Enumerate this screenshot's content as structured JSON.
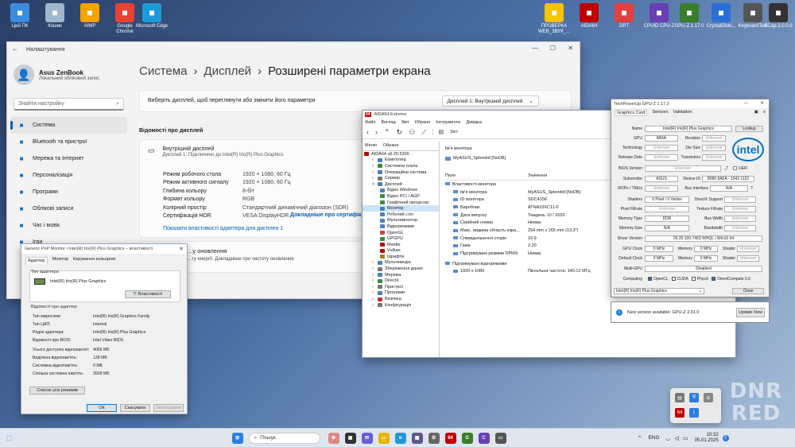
{
  "desktop_icons": [
    {
      "label": "Цей ПК",
      "icon": "computer-icon",
      "color": "#3a8dde"
    },
    {
      "label": "Кошик",
      "icon": "recycle-bin-icon",
      "color": "#9fb6cc"
    },
    {
      "label": "AIMP",
      "icon": "aimp-icon",
      "color": "#f4a300"
    },
    {
      "label": "Google Chrome",
      "icon": "chrome-icon",
      "color": "#e94235"
    },
    {
      "label": "Microsoft Edge",
      "icon": "edge-icon",
      "color": "#1f9ad6"
    },
    {
      "label": "ПРОВЕРКА WEB_ЗВУК_...",
      "icon": "warning-icon",
      "color": "#f5c400"
    },
    {
      "label": "AIDA64",
      "icon": "aida64-icon",
      "color": "#c00000"
    },
    {
      "label": "DPT",
      "icon": "dpt-icon",
      "color": "#e04040"
    },
    {
      "label": "CPUID CPU-Z",
      "icon": "cpuz-icon",
      "color": "#6a3fb5"
    },
    {
      "label": "GPU-Z.1.17.0",
      "icon": "gpuz-icon",
      "color": "#3a7d2a"
    },
    {
      "label": "CrystalDiski...",
      "icon": "crystaldisk-icon",
      "color": "#2a6fd6"
    },
    {
      "label": "KeyboardTest",
      "icon": "keyboard-icon",
      "color": "#555555"
    },
    {
      "label": "ECap-1.0.0.9",
      "icon": "camera-icon",
      "color": "#333333"
    }
  ],
  "settings": {
    "window_title": "Налаштування",
    "account_name": "Asus ZenBook",
    "account_type": "Локальний обліковий запис",
    "search_placeholder": "Знайти настройку",
    "nav": [
      {
        "label": "Система",
        "icon": "system-icon"
      },
      {
        "label": "Bluetooth та пристрої",
        "icon": "bluetooth-icon"
      },
      {
        "label": "Мережа та Інтернет",
        "icon": "network-icon"
      },
      {
        "label": "Персоналізація",
        "icon": "personalization-icon"
      },
      {
        "label": "Програми",
        "icon": "apps-icon"
      },
      {
        "label": "Облікові записи",
        "icon": "accounts-icon"
      },
      {
        "label": "Час і мова",
        "icon": "time-icon"
      },
      {
        "label": "Ігри",
        "icon": "games-icon"
      }
    ],
    "crumb_1": "Система",
    "crumb_2": "Дисплей",
    "crumb_3": "Розширені параметри екрана",
    "select_prompt": "Виберіть дисплей, щоб переглянути або змінити його параметри",
    "display_select": "Дисплей 1: Внутрішній дисплей",
    "info_title": "Відомості про дисплей",
    "display_name": "Внутрішній дисплей",
    "display_sub": "Дисплей 1: Підключено до Intel(R) Iris(R) Plus Graphics",
    "rows": [
      {
        "k": "Режим робочого стола",
        "v": "1920 × 1080, 60 Гц"
      },
      {
        "k": "Режим активного сигналу",
        "v": "1920 × 1080, 60 Гц"
      },
      {
        "k": "Глибина кольору",
        "v": "8-біт"
      },
      {
        "k": "Формат кольору",
        "v": "RGB"
      },
      {
        "k": "Колірний простір",
        "v": "Стандартний динамічний діапазон (SDR)"
      },
      {
        "k": "Сертифікація HDR",
        "v": "VESA DisplayHDR"
      }
    ],
    "hdr_link": "Докладніше про сертифік...",
    "adapter_link": "Показати властивості адаптера для дисплея 1",
    "refresh_title": "...у оновлення",
    "refresh_text": "...ту енергії. Докладніше про частоту оновлення"
  },
  "props": {
    "title": "Generic PnP Monitor і Intel(R) Iris(R) Plus Graphics – властивості",
    "tabs": [
      "Адаптер",
      "Монітор",
      "Керування кольором"
    ],
    "adapter_type_label": "Тип адаптера",
    "adapter_name": "Intel(R) Iris(R) Plus Graphics",
    "properties_button": "Властивості",
    "info_label": "Відомості про адаптер",
    "rows": [
      {
        "k": "Тип мікросхем:",
        "v": "Intel(R) Iris(R) Graphics Family"
      },
      {
        "k": "Тип ЦАП:",
        "v": "Internal"
      },
      {
        "k": "Рядок адаптера:",
        "v": "Intel(R) Iris(R) Plus Graphics"
      },
      {
        "k": "Відомості про BIOS:",
        "v": "Intel Video BIOS"
      }
    ],
    "mem_rows": [
      {
        "k": "Усього доступно відеопам'яті:",
        "v": "4056 МБ"
      },
      {
        "k": "Виділена відеопам'ять:",
        "v": "128 МБ"
      },
      {
        "k": "Системна відеопам'ять:",
        "v": "0 МБ"
      },
      {
        "k": "Спільна системна пам'ять:",
        "v": "3928 МБ"
      }
    ],
    "modes_button": "Список усіх режимів",
    "ok": "ОК",
    "cancel": "Скасувати",
    "apply": "Застосувати"
  },
  "aida": {
    "title": "AIDA64 Extreme",
    "menu": [
      "Файл",
      "Вигляд",
      "Звіт",
      "Обране",
      "Інструменти",
      "Довідка"
    ],
    "report_tab": "Звіт",
    "tree_tabs": [
      "Меню",
      "Обране"
    ],
    "tree": [
      {
        "label": "AIDA64 v6.20.5300",
        "level": 0,
        "color": "#c00000"
      },
      {
        "label": "Комп'ютер",
        "level": 1,
        "color": "#4a7fc1"
      },
      {
        "label": "Системна плата",
        "level": 1,
        "color": "#3a8a3a"
      },
      {
        "label": "Операційна система",
        "level": 1,
        "color": "#4a7fc1"
      },
      {
        "label": "Сервер",
        "level": 1,
        "color": "#777777"
      },
      {
        "label": "Дисплей",
        "level": 1,
        "color": "#4a7fc1"
      },
      {
        "label": "Відео Windows",
        "level": 2,
        "color": "#4a7fc1"
      },
      {
        "label": "Відео PCI / AGP",
        "level": 2,
        "color": "#3a8a3a"
      },
      {
        "label": "Графічний процесор",
        "level": 2,
        "color": "#3a8a3a"
      },
      {
        "label": "Монітор",
        "level": 2,
        "color": "#4a7fc1",
        "selected": true
      },
      {
        "label": "Робочий стіл",
        "level": 2,
        "color": "#4a7fc1"
      },
      {
        "label": "Мультимонітор",
        "level": 2,
        "color": "#4a7fc1"
      },
      {
        "label": "Відеорежими",
        "level": 2,
        "color": "#4a7fc1"
      },
      {
        "label": "OpenGL",
        "level": 2,
        "color": "#d04040"
      },
      {
        "label": "GPGPU",
        "level": 2,
        "color": "#3a8a3a"
      },
      {
        "label": "Mantle",
        "level": 2,
        "color": "#c00000"
      },
      {
        "label": "Vulkan",
        "level": 2,
        "color": "#c00000"
      },
      {
        "label": "Шрифти",
        "level": 2,
        "color": "#a08020"
      },
      {
        "label": "Мультимедіа",
        "level": 1,
        "color": "#4a7fc1"
      },
      {
        "label": "Збереження даних",
        "level": 1,
        "color": "#777777"
      },
      {
        "label": "Мережа",
        "level": 1,
        "color": "#4a7fc1"
      },
      {
        "label": "DirectX",
        "level": 1,
        "color": "#3a8a3a"
      },
      {
        "label": "Пристрої",
        "level": 1,
        "color": "#777777"
      },
      {
        "label": "Програми",
        "level": 1,
        "color": "#4a7fc1"
      },
      {
        "label": "Безпека",
        "level": 1,
        "color": "#c03030"
      },
      {
        "label": "Конфігурація",
        "level": 1,
        "color": "#777777"
      }
    ],
    "monitor_name_label": "Ім'я монітора",
    "monitor_name_value": "MyASUS_Splendid [NoDB]",
    "col_field": "Поле",
    "col_value": "Значення",
    "group1": "Властивості монітора",
    "props": [
      {
        "f": "Ім'я монітора",
        "v": "MyASUS_Splendid [NoDB]"
      },
      {
        "f": "ID монітора",
        "v": "SDC4158"
      },
      {
        "f": "Виробник",
        "v": "ATNA33XC11-0"
      },
      {
        "f": "Дата випуску",
        "v": "Тиждень 10 / 2020"
      },
      {
        "f": "Серійний номер",
        "v": "Немає"
      },
      {
        "f": "Макс. видима область екра...",
        "v": "294 mm x 165 mm (13.3\")"
      },
      {
        "f": "Співвідношення сторін",
        "v": "16:9"
      },
      {
        "f": "Гама",
        "v": "2.20"
      },
      {
        "f": "Підтримувані режими DPMS",
        "v": "Немає"
      }
    ],
    "group2": "Підтримувані відеорежими",
    "mode_res": "1920 x 1080",
    "mode_freq": "Піксельна частота: 140.12 МГц"
  },
  "gpuz": {
    "title": "TechPowerUp GPU-Z 1.17.0",
    "tabs": [
      "Graphics Card",
      "Sensors",
      "Validation"
    ],
    "name": "Intel(R) Iris(R) Plus Graphics",
    "lookup": "Lookup",
    "gpu": "8A5A",
    "revision_label": "Revision",
    "revision": "Unknown",
    "technology_label": "Technology",
    "technology": "Unknown",
    "die_size_label": "Die Size",
    "die_size": "Unknown",
    "release_date_label": "Release Date",
    "release_date": "Unknown",
    "transistors_label": "Transistors",
    "transistors": "Unknown",
    "bios_label": "BIOS Version",
    "bios": "Unknown",
    "uefi": "UEFI",
    "subvendor_label": "Subvendor",
    "subvendor": "ASUS",
    "device_id_label": "Device ID",
    "device_id": "8086 8A5A - 1043 1122",
    "rops_label": "ROPs / TMUs",
    "rops": "Unknown",
    "bus_label": "Bus Interface",
    "bus": "N/A",
    "shaders_label": "Shaders",
    "shaders": "0 Pixel / 0 Vertex",
    "directx_label": "DirectX Support",
    "directx": "Unknown",
    "pixel_label": "Pixel Fillrate",
    "pixel": "Unknown",
    "texture_label": "Texture Fillrate",
    "texture": "Unknown",
    "memtype_label": "Memory Type",
    "memtype": "DDR",
    "buswidth_label": "Bus Width",
    "buswidth": "Unknown",
    "memsize_label": "Memory Size",
    "memsize": "N/A",
    "bandwidth_label": "Bandwidth",
    "bandwidth": "Unknown",
    "driver_label": "Driver Version",
    "driver": "26.20.100.7463 WHQL / Win10 64",
    "gpuclock_label": "GPU Clock",
    "gpuclock": "0 MHz",
    "memory_label": "Memory",
    "memclock": "0 MHz",
    "shader_label": "Shader",
    "shaderclock": "Unknown",
    "defclock_label": "Default Clock",
    "defclock": "0 MHz",
    "defmem": "0 MHz",
    "defshader": "Unknown",
    "multigpu_label": "Multi-GPU",
    "multigpu": "Disabled",
    "computing_label": "Computing",
    "computing": [
      "OpenCL",
      "CUDA",
      "PhysX",
      "DirectCompute 5.0"
    ],
    "selected_gpu": "Intel(R) Iris(R) Plus Graphics",
    "close": "Close",
    "update_text": "New version available: GPU-Z 2.61.0",
    "update_button": "Update Now"
  },
  "watermark": "DNR RED",
  "taskbar": {
    "search_placeholder": "Пошук",
    "lang": "ENG",
    "time": "10:32",
    "date": "05.01.2025",
    "notif_count": "5"
  }
}
